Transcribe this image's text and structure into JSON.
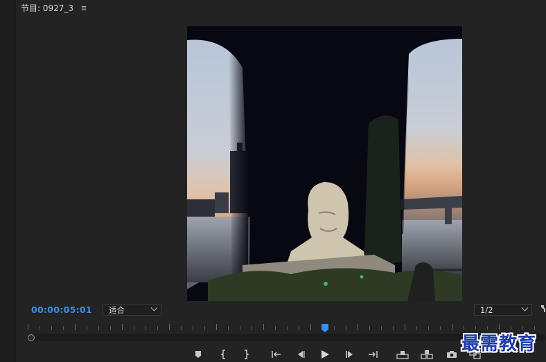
{
  "panel": {
    "title": "节目: 0927_3",
    "menu_icon": "hamburger-icon"
  },
  "timecode": "00:00:05:01",
  "zoom": {
    "selected": "适合"
  },
  "resolution": {
    "selected": "1/2"
  },
  "playhead": {
    "color": "#3d8ee8"
  },
  "controls": [
    {
      "name": "add-marker-button",
      "icon": "marker-icon"
    },
    {
      "name": "mark-in-button",
      "icon": "mark-in-icon"
    },
    {
      "name": "mark-out-button",
      "icon": "mark-out-icon"
    },
    {
      "name": "go-to-in-button",
      "icon": "go-to-in-icon"
    },
    {
      "name": "step-back-button",
      "icon": "step-back-icon"
    },
    {
      "name": "play-button",
      "icon": "play-icon"
    },
    {
      "name": "step-forward-button",
      "icon": "step-forward-icon"
    },
    {
      "name": "go-to-out-button",
      "icon": "go-to-out-icon"
    },
    {
      "name": "lift-button",
      "icon": "lift-icon"
    },
    {
      "name": "extract-button",
      "icon": "extract-icon"
    },
    {
      "name": "export-frame-button",
      "icon": "camera-icon"
    },
    {
      "name": "comparison-view-button",
      "icon": "comparison-icon"
    }
  ],
  "watermark": "最需教育",
  "colors": {
    "accent": "#3d8ee8",
    "background": "#232323",
    "watermark": "#1d3ca8"
  }
}
